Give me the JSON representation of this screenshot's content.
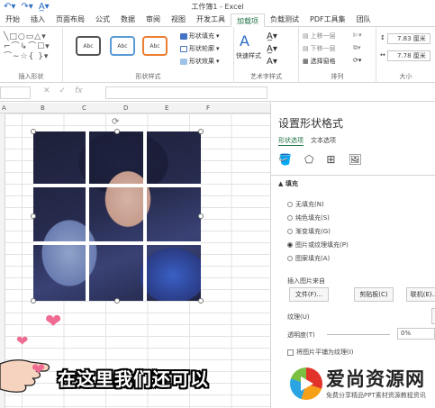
{
  "window": {
    "title": "工作簿1 - Excel",
    "undo_icon": "undo-icon",
    "redo_icon": "redo-icon",
    "font_color_icon": "font-color-icon"
  },
  "tabs": [
    "开始",
    "插入",
    "页面布局",
    "公式",
    "数据",
    "审阅",
    "视图",
    "开发工具",
    "加载项",
    "负载测试",
    "PDF工具集",
    "团队"
  ],
  "active_tab_index": 8,
  "ribbon": {
    "insert_shapes_label": "插入形状",
    "shape_styles_label": "形状样式",
    "style_samples": [
      "Abc",
      "Abc",
      "Abc"
    ],
    "shape_fill": "形状填充",
    "shape_outline": "形状轮廓",
    "shape_effects": "形状效果",
    "quick_styles": "快速样式",
    "wordart_label": "艺术字样式",
    "bring_forward": "上移一层",
    "send_backward": "下移一层",
    "selection_pane": "选择窗格",
    "arrange_label": "排列",
    "height_value": "7.83 厘米",
    "width_value": "7.78 厘米",
    "size_label": "大小"
  },
  "formula_bar": {
    "cancel": "✕",
    "confirm": "✓",
    "fx": "fx"
  },
  "columns": [
    "A",
    "B",
    "C",
    "D",
    "E",
    "F"
  ],
  "pane": {
    "title": "设置形状格式",
    "tab_shape": "形状选项",
    "tab_text": "文本选项",
    "section_fill": "▲ 填充",
    "fill_options": [
      "无填充(N)",
      "纯色填充(S)",
      "渐变填充(G)",
      "图片或纹理填充(P)",
      "图案填充(A)"
    ],
    "selected_fill_index": 3,
    "insert_from": "插入图片来自",
    "file_button": "文件(F)...",
    "clipboard_button": "剪贴板(C)",
    "online_button": "联机(E)...",
    "texture_label": "纹理(U)",
    "transparency_label": "透明度(T)",
    "transparency_value": "0%",
    "tile_checkbox": "将图片平铺为纹理(I)"
  },
  "overlay": {
    "caption": "在这里我们还可以",
    "watermark_title": "爱尚资源网",
    "watermark_sub": "免费分享精品PPT素材资源教程资讯"
  },
  "colors": {
    "accent": "#217346",
    "heart": "#f06b92"
  }
}
